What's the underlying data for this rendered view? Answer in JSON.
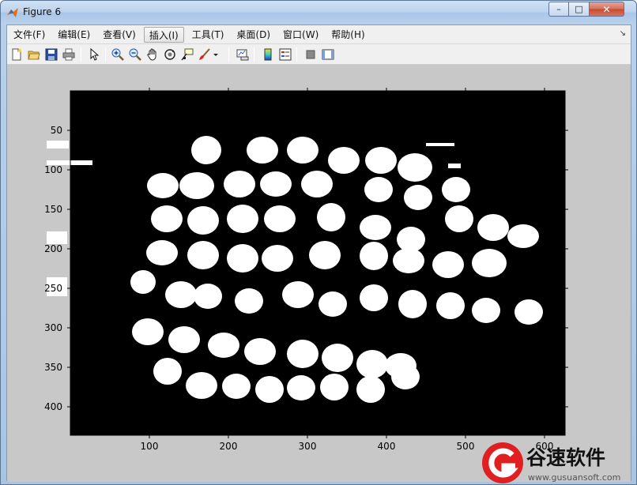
{
  "window": {
    "title": "Figure 6",
    "controls": {
      "minimize": "–",
      "maximize": "□",
      "close": "✕"
    }
  },
  "menu": {
    "items": [
      {
        "label": "文件(F)",
        "name": "menu-file"
      },
      {
        "label": "编辑(E)",
        "name": "menu-edit"
      },
      {
        "label": "查看(V)",
        "name": "menu-view"
      },
      {
        "label": "插入(I)",
        "name": "menu-insert",
        "active": true
      },
      {
        "label": "工具(T)",
        "name": "menu-tools"
      },
      {
        "label": "桌面(D)",
        "name": "menu-desktop"
      },
      {
        "label": "窗口(W)",
        "name": "menu-window"
      },
      {
        "label": "帮助(H)",
        "name": "menu-help"
      }
    ],
    "overflow_arrow": "↘"
  },
  "toolbar": {
    "buttons": [
      "new-figure-icon",
      "open-file-icon",
      "save-icon",
      "print-icon",
      "edit-plot-arrow-icon",
      "zoom-in-icon",
      "zoom-out-icon",
      "pan-hand-icon",
      "rotate-3d-icon",
      "data-cursor-icon",
      "brush-icon",
      "brush-dropdown-icon",
      "link-plot-icon",
      "insert-colorbar-icon",
      "insert-legend-icon",
      "hide-plot-tools-icon",
      "show-plot-tools-icon"
    ]
  },
  "chart_data": {
    "type": "image",
    "description_kind": "binary image (imshow)",
    "x_ticks": [
      "100",
      "200",
      "300",
      "400",
      "500",
      "600"
    ],
    "y_ticks": [
      "50",
      "100",
      "150",
      "200",
      "250",
      "300",
      "350",
      "400"
    ],
    "xlim": [
      0,
      626
    ],
    "ylim": [
      436,
      0
    ],
    "grid": false,
    "background_color": "#000000",
    "foreground_color": "#ffffff"
  },
  "watermark": {
    "text": "谷速软件",
    "url_text": "www.gusuansoft.com",
    "accent_color": "#e02020"
  }
}
